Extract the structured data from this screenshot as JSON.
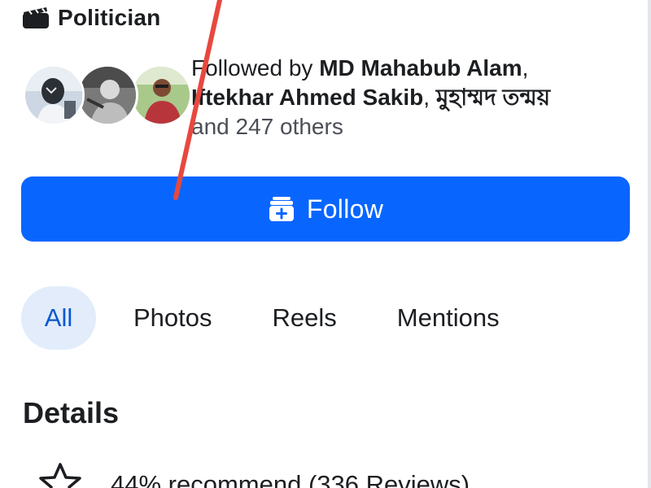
{
  "page_category": {
    "label": "Politician",
    "icon": "clapperboard-icon"
  },
  "followers": {
    "prefix": "Followed by ",
    "name_1": "MD Mahabub Alam",
    "separator_1": ",",
    "name_2": "Iftekhar Ahmed Sakib",
    "separator_2": ", ",
    "name_3": "মুহাম্মদ তন্ময়",
    "suffix": "and 247 others",
    "avatar_count": 3
  },
  "follow_button": {
    "label": "Follow",
    "icon": "follow-page-icon"
  },
  "tabs": [
    {
      "label": "All",
      "active": true
    },
    {
      "label": "Photos",
      "active": false
    },
    {
      "label": "Reels",
      "active": false
    },
    {
      "label": "Mentions",
      "active": false
    }
  ],
  "details": {
    "title": "Details",
    "recommend_text": "44% recommend (336 Reviews)",
    "recommend_icon": "star-icon"
  },
  "colors": {
    "primary_blue": "#0866ff",
    "active_tab_bg": "#e2ecfb",
    "active_tab_text": "#0a58d0",
    "annotation_red": "#e8483e"
  }
}
